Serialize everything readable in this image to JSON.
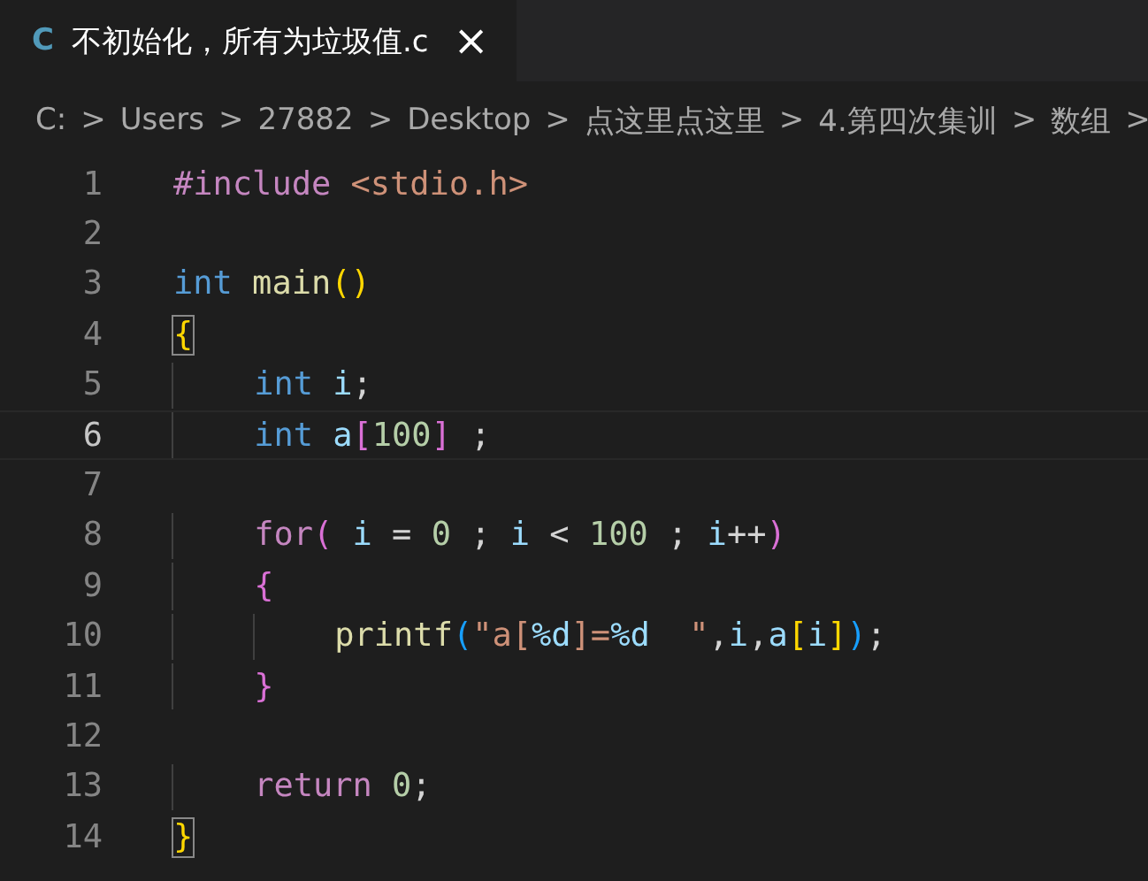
{
  "tabs": [
    {
      "lang_badge": "C",
      "label": "不初始化，所有为垃圾值.c",
      "close": "×",
      "selected": true
    }
  ],
  "breadcrumbs": {
    "items": [
      "C:",
      "Users",
      "27882",
      "Desktop",
      "点这里点这里",
      "4.第四次集训",
      "数组"
    ],
    "separator": ">"
  },
  "editor": {
    "lines": [
      {
        "number": "1",
        "current": false,
        "tokens": [
          {
            "text": "#include",
            "kind": "keyword"
          },
          {
            "text": " <stdio.h>",
            "kind": "string"
          }
        ]
      },
      {
        "number": "2",
        "current": false
      },
      {
        "number": "3",
        "current": false,
        "tokens": [
          {
            "text": "int",
            "kind": "type"
          },
          {
            "text": " main",
            "kind": "function"
          },
          {
            "text": "()",
            "kind": "bracket"
          }
        ]
      },
      {
        "number": "4",
        "current": false,
        "tokens": [
          {
            "text": "{",
            "kind": "bracket",
            "matched": true
          }
        ]
      },
      {
        "number": "5",
        "current": false,
        "tokens": [
          {
            "text": "    int",
            "kind": "type"
          },
          {
            "text": " i",
            "kind": "variable"
          },
          {
            "text": ";",
            "kind": "plain"
          }
        ]
      },
      {
        "number": "6",
        "current": true,
        "tokens": [
          {
            "text": "    int",
            "kind": "type"
          },
          {
            "text": " a",
            "kind": "variable"
          },
          {
            "text": "[",
            "kind": "bracket2"
          },
          {
            "text": "100",
            "kind": "number"
          },
          {
            "text": "]",
            "kind": "bracket2"
          },
          {
            "text": " ;",
            "kind": "plain"
          }
        ]
      },
      {
        "number": "7",
        "current": false
      },
      {
        "number": "8",
        "current": false,
        "tokens": [
          {
            "text": "    for",
            "kind": "keyword"
          },
          {
            "text": "(",
            "kind": "bracket2"
          },
          {
            "text": " i",
            "kind": "variable"
          },
          {
            "text": " = ",
            "kind": "plain"
          },
          {
            "text": "0",
            "kind": "number"
          },
          {
            "text": " ; ",
            "kind": "plain"
          },
          {
            "text": "i",
            "kind": "variable"
          },
          {
            "text": " < ",
            "kind": "plain"
          },
          {
            "text": "100",
            "kind": "number"
          },
          {
            "text": " ; ",
            "kind": "plain"
          },
          {
            "text": "i",
            "kind": "variable"
          },
          {
            "text": "++",
            "kind": "plain"
          },
          {
            "text": ")",
            "kind": "bracket2"
          }
        ]
      },
      {
        "number": "9",
        "current": false,
        "tokens": [
          {
            "text": "    {",
            "kind": "bracket2"
          }
        ]
      },
      {
        "number": "10",
        "current": false,
        "tokens": [
          {
            "text": "        printf",
            "kind": "function"
          },
          {
            "text": "(",
            "kind": "bracket3"
          },
          {
            "text": "\"a[",
            "kind": "string"
          },
          {
            "text": "%d",
            "kind": "escape"
          },
          {
            "text": "]=",
            "kind": "string"
          },
          {
            "text": "%d",
            "kind": "escape"
          },
          {
            "text": "  \"",
            "kind": "string"
          },
          {
            "text": ",",
            "kind": "plain"
          },
          {
            "text": "i",
            "kind": "variable"
          },
          {
            "text": ",",
            "kind": "plain"
          },
          {
            "text": "a",
            "kind": "variable"
          },
          {
            "text": "[",
            "kind": "bracket"
          },
          {
            "text": "i",
            "kind": "variable"
          },
          {
            "text": "]",
            "kind": "bracket"
          },
          {
            "text": ")",
            "kind": "bracket3"
          },
          {
            "text": ";",
            "kind": "plain"
          }
        ]
      },
      {
        "number": "11",
        "current": false,
        "tokens": [
          {
            "text": "    }",
            "kind": "bracket2"
          }
        ]
      },
      {
        "number": "12",
        "current": false
      },
      {
        "number": "13",
        "current": false,
        "tokens": [
          {
            "text": "    return",
            "kind": "keyword"
          },
          {
            "text": " 0",
            "kind": "number"
          },
          {
            "text": ";",
            "kind": "plain"
          }
        ]
      },
      {
        "number": "14",
        "current": false,
        "tokens": [
          {
            "text": "}",
            "kind": "bracket",
            "matched": true
          }
        ]
      }
    ]
  }
}
